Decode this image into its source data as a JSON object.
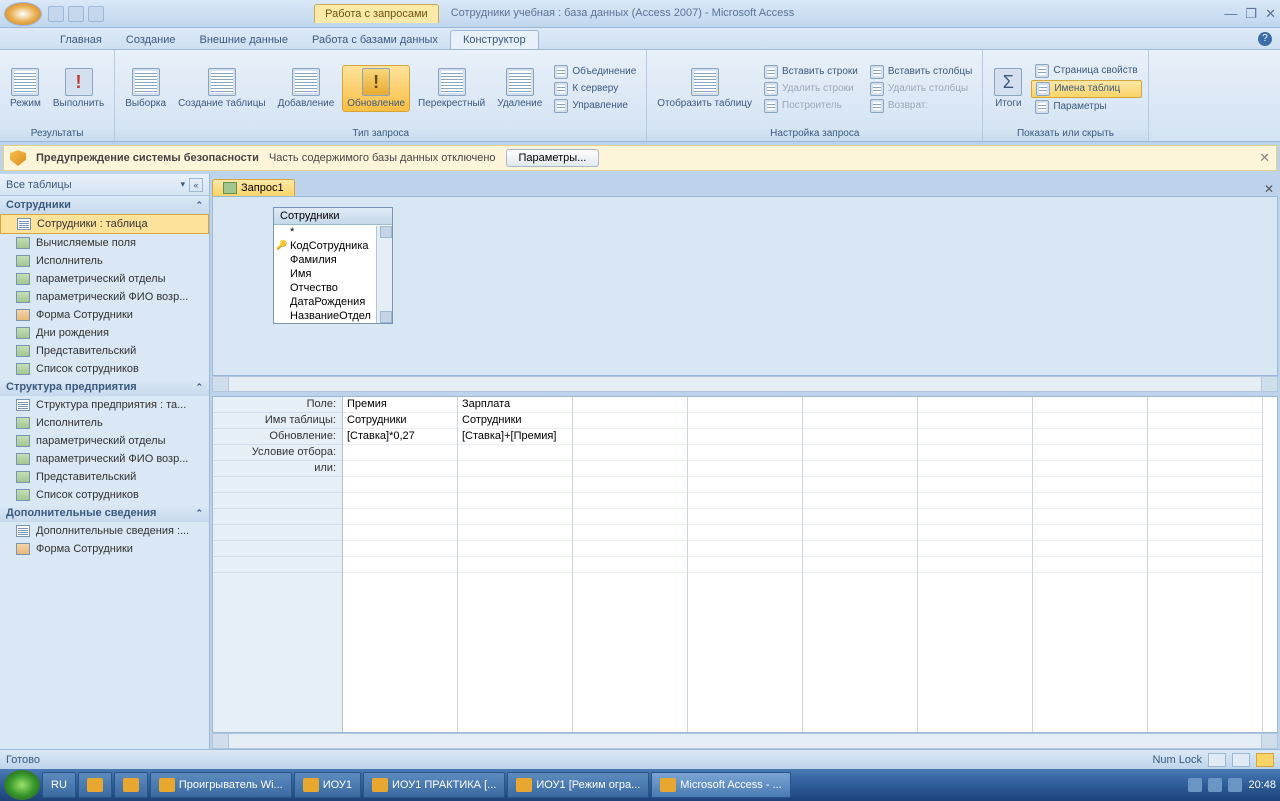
{
  "titlebar": {
    "context_tab": "Работа с запросами",
    "doc_title": "Сотрудники учебная : база данных (Access 2007) - Microsoft Access"
  },
  "tabs": {
    "t1": "Главная",
    "t2": "Создание",
    "t3": "Внешние данные",
    "t4": "Работа с базами данных",
    "t5": "Конструктор"
  },
  "ribbon": {
    "g1": {
      "label": "Результаты",
      "b1": "Режим",
      "b2": "Выполнить"
    },
    "g2": {
      "label": "Тип запроса",
      "b1": "Выборка",
      "b2": "Создание\nтаблицы",
      "b3": "Добавление",
      "b4": "Обновление",
      "b5": "Перекрестный",
      "b6": "Удаление",
      "s1": "Объединение",
      "s2": "К серверу",
      "s3": "Управление"
    },
    "g3": {
      "label": "Настройка запроса",
      "b1": "Отобразить\nтаблицу",
      "r1": "Вставить строки",
      "r2": "Удалить строки",
      "r3": "Построитель",
      "c1": "Вставить столбцы",
      "c2": "Удалить столбцы",
      "c3": "Возврат:"
    },
    "g4": {
      "label": "Показать или скрыть",
      "b1": "Итоги",
      "s1": "Страница свойств",
      "s2": "Имена таблиц",
      "s3": "Параметры"
    }
  },
  "security": {
    "title": "Предупреждение системы безопасности",
    "msg": "Часть содержимого базы данных отключено",
    "btn": "Параметры..."
  },
  "nav": {
    "header": "Все таблицы",
    "g1": {
      "h": "Сотрудники",
      "items": [
        "Сотрудники : таблица",
        "Вычисляемые поля",
        "Исполнитель",
        "параметрический отделы",
        "параметрический ФИО возр...",
        "Форма Сотрудники",
        "Дни рождения",
        "Представительский",
        "Список сотрудников"
      ]
    },
    "g2": {
      "h": "Структура предприятия",
      "items": [
        "Структура предприятия : та...",
        "Исполнитель",
        "параметрический отделы",
        "параметрический ФИО возр...",
        "Представительский",
        "Список сотрудников"
      ]
    },
    "g3": {
      "h": "Дополнительные сведения",
      "items": [
        "Дополнительные сведения :...",
        "Форма Сотрудники"
      ]
    }
  },
  "doc": {
    "tab": "Запрос1"
  },
  "tablebox": {
    "title": "Сотрудники",
    "fields": [
      "*",
      "КодСотрудника",
      "Фамилия",
      "Имя",
      "Отчество",
      "ДатаРождения",
      "НазваниеОтдел"
    ]
  },
  "grid": {
    "rows": [
      "Поле:",
      "Имя таблицы:",
      "Обновление:",
      "Условие отбора:",
      "или:"
    ],
    "col1": {
      "field": "Премия",
      "table": "Сотрудники",
      "update": "[Ставка]*0,27"
    },
    "col2": {
      "field": "Зарплата",
      "table": "Сотрудники",
      "update": "[Ставка]+[Премия]"
    }
  },
  "status": {
    "left": "Готово",
    "numlock": "Num Lock"
  },
  "taskbar": {
    "lang": "RU",
    "items": [
      "Проигрыватель Wi...",
      "ИОУ1",
      "ИОУ1 ПРАКТИКА [...",
      "ИОУ1 [Режим огра...",
      "Microsoft Access - ..."
    ],
    "time": "20:48"
  }
}
